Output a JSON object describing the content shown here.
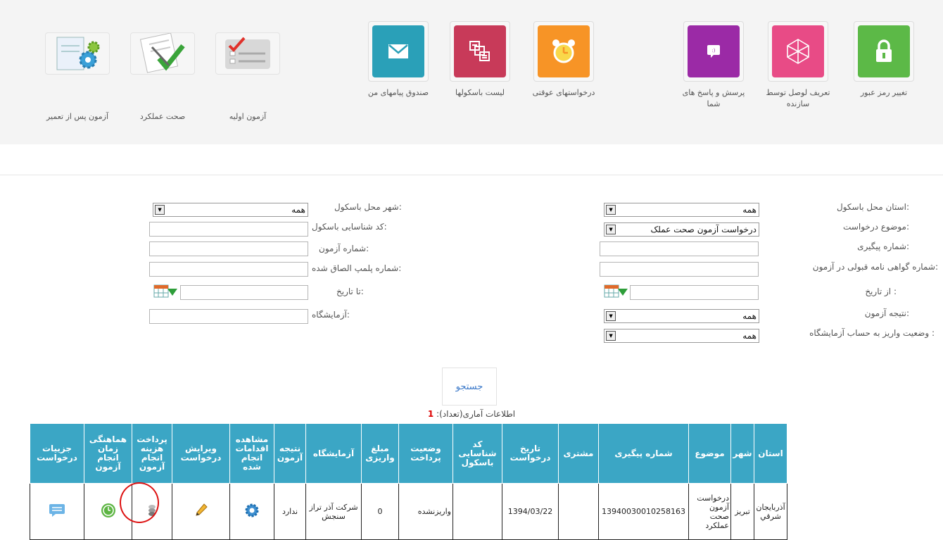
{
  "toolbar": {
    "tiles": [
      {
        "label": "تغییر رمز عبور",
        "color": "#5cb947"
      },
      {
        "label": "تعریف لوصل توسط سازنده",
        "color": "#e84b86"
      },
      {
        "label": "پرسش و پاسخ های شما",
        "color": "#9b2aa6"
      },
      {
        "label": "درخواستهای عوقتی",
        "color": "#f79426"
      },
      {
        "label": "لیست باسکولها",
        "color": "#c83a59"
      },
      {
        "label": "صندوق پیامهای من",
        "color": "#2aa0b8"
      },
      {
        "label": "آزمون اولیه"
      },
      {
        "label": "صحت عملکرد"
      },
      {
        "label": "آزمون پس از تعمیر"
      }
    ]
  },
  "form": {
    "province_label": "استان محل باسکول:",
    "province_value": "همه",
    "subject_label": "موضوع درخواست:",
    "subject_value": "درخواست آزمون صحت عملک",
    "tracking_label": "شماره پیگیری:",
    "certificate_label": "شماره گواهی نامه قبولی در آزمون:",
    "from_date_label": "از تاریخ :",
    "result_label": "نتیجه آزمون:",
    "result_value": "همه",
    "payment_status_label": "وضعیت واریز به حساب آزمایشگاه :",
    "payment_status_value": "همه",
    "city_label": "شهر محل باسکول:",
    "city_value": "همه",
    "scale_id_label": "کد شناسایی باسکول:",
    "test_no_label": "شماره آزمون:",
    "seal_label": "شماره پلمپ الصاق شده:",
    "to_date_label": "تا تاریخ:",
    "lab_label": "آزمایشگاه:"
  },
  "search": {
    "label": "جستجو"
  },
  "stats": {
    "label": "اطلاعات آماری(تعداد):",
    "count": "1"
  },
  "table": {
    "headers": [
      "استان",
      "شهر",
      "موضوع",
      "شماره پیگیری",
      "مشتری",
      "تاریخ درخواست",
      "کد شناسایی باسکول",
      "وضعیت پرداخت",
      "مبلغ واریزی",
      "آزمایشگاه",
      "نتیجه آزمون",
      "مشاهده اقدامات انجام شده",
      "ویرایش درخواست",
      "پرداخت هزینه انجام آزمون",
      "هماهنگی زمان انجام آزمون",
      "جزییات درخواست"
    ],
    "row": {
      "province": "آذربایجان شرقي",
      "city": "تبریز",
      "subject": "درخواست آزمون صحت عملکرد",
      "tracking": "13940030010258163",
      "customer": "",
      "date": "1394/03/22",
      "scale_code": "",
      "payment_status": "واریزنشده",
      "amount": "0",
      "lab": "شرکت آذر تراز سنجش",
      "result": "ندارد"
    }
  },
  "colors": {
    "header_bg": "#3ba6c5",
    "highlight": "#dd1111"
  }
}
